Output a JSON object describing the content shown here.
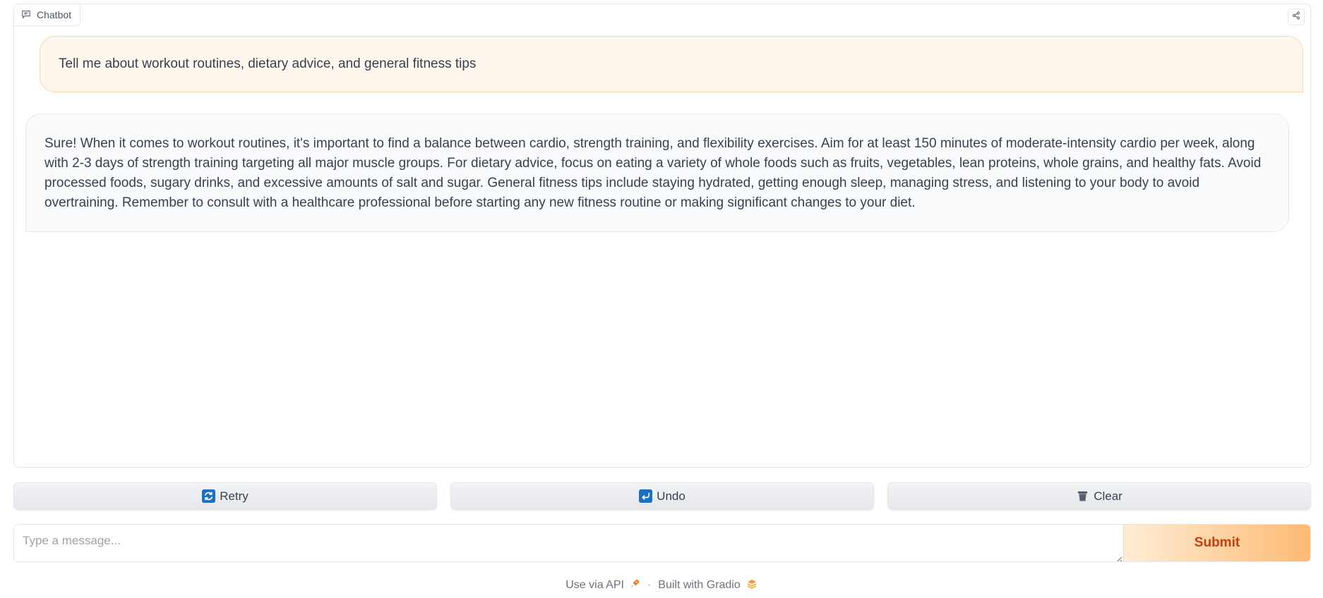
{
  "chatbot": {
    "label": "Chatbot",
    "messages": [
      {
        "role": "user",
        "text": "Tell me about workout routines, dietary advice, and general fitness tips"
      },
      {
        "role": "bot",
        "text": "Sure! When it comes to workout routines, it's important to find a balance between cardio, strength training, and flexibility exercises. Aim for at least 150 minutes of moderate-intensity cardio per week, along with 2-3 days of strength training targeting all major muscle groups. For dietary advice, focus on eating a variety of whole foods such as fruits, vegetables, lean proteins, whole grains, and healthy fats. Avoid processed foods, sugary drinks, and excessive amounts of salt and sugar. General fitness tips include staying hydrated, getting enough sleep, managing stress, and listening to your body to avoid overtraining. Remember to consult with a healthcare professional before starting any new fitness routine or making significant changes to your diet."
      }
    ]
  },
  "buttons": {
    "retry": {
      "label": "Retry",
      "icon": "retry-icon"
    },
    "undo": {
      "label": "Undo",
      "icon": "undo-icon"
    },
    "clear": {
      "label": "Clear",
      "icon": "wastebasket-icon"
    }
  },
  "input": {
    "placeholder": "Type a message...",
    "value": ""
  },
  "submit": {
    "label": "Submit"
  },
  "footer": {
    "api_label": "Use via API",
    "separator": "·",
    "built_label": "Built with Gradio"
  },
  "colors": {
    "accent": "#ea580c",
    "user_bubble": "#fff7ed",
    "bot_bubble": "#f9fafb"
  }
}
